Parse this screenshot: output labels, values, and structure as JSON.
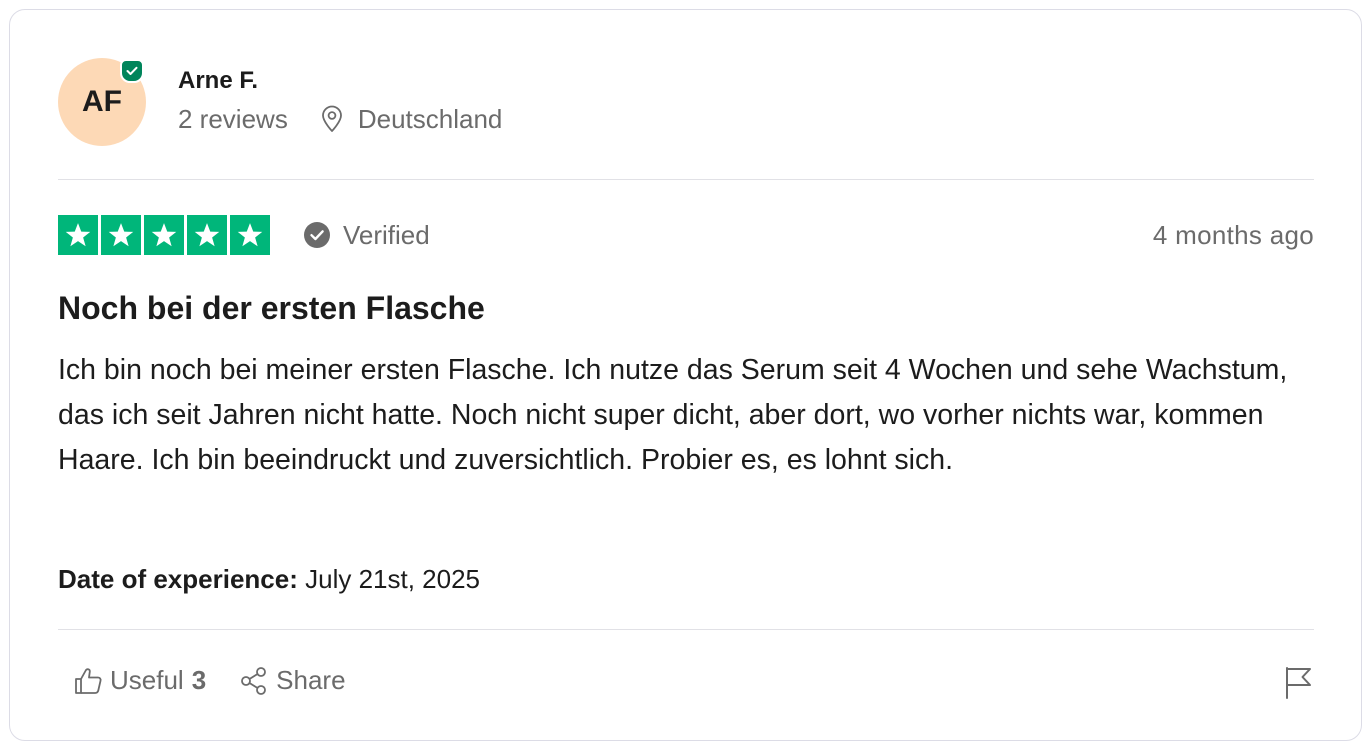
{
  "reviewer": {
    "initials": "AF",
    "name": "Arne F.",
    "reviews_count": "2 reviews",
    "location": "Deutschland",
    "avatar_color": "#fdd9b6",
    "badge_color": "#00855b"
  },
  "review": {
    "rating": 5,
    "max_rating": 5,
    "star_color": "#00b67a",
    "verified_label": "Verified",
    "posted_ago": "4 months ago",
    "title": "Noch bei der ersten Flasche",
    "text": "Ich bin noch bei meiner ersten Flasche. Ich nutze das Serum seit 4 Wochen und sehe Wachstum, das ich seit Jahren nicht hatte. Noch nicht super dicht, aber dort, wo vorher nichts war, kommen Haare. Ich bin beeindruckt und zuversichtlich. Probier es, es lohnt sich.",
    "experience_label": "Date of experience:",
    "experience_date": "July 21st, 2025"
  },
  "actions": {
    "useful_label": "Useful",
    "useful_count": "3",
    "share_label": "Share",
    "icons": [
      "thumbs-up-icon",
      "share-icon",
      "flag-icon"
    ]
  }
}
